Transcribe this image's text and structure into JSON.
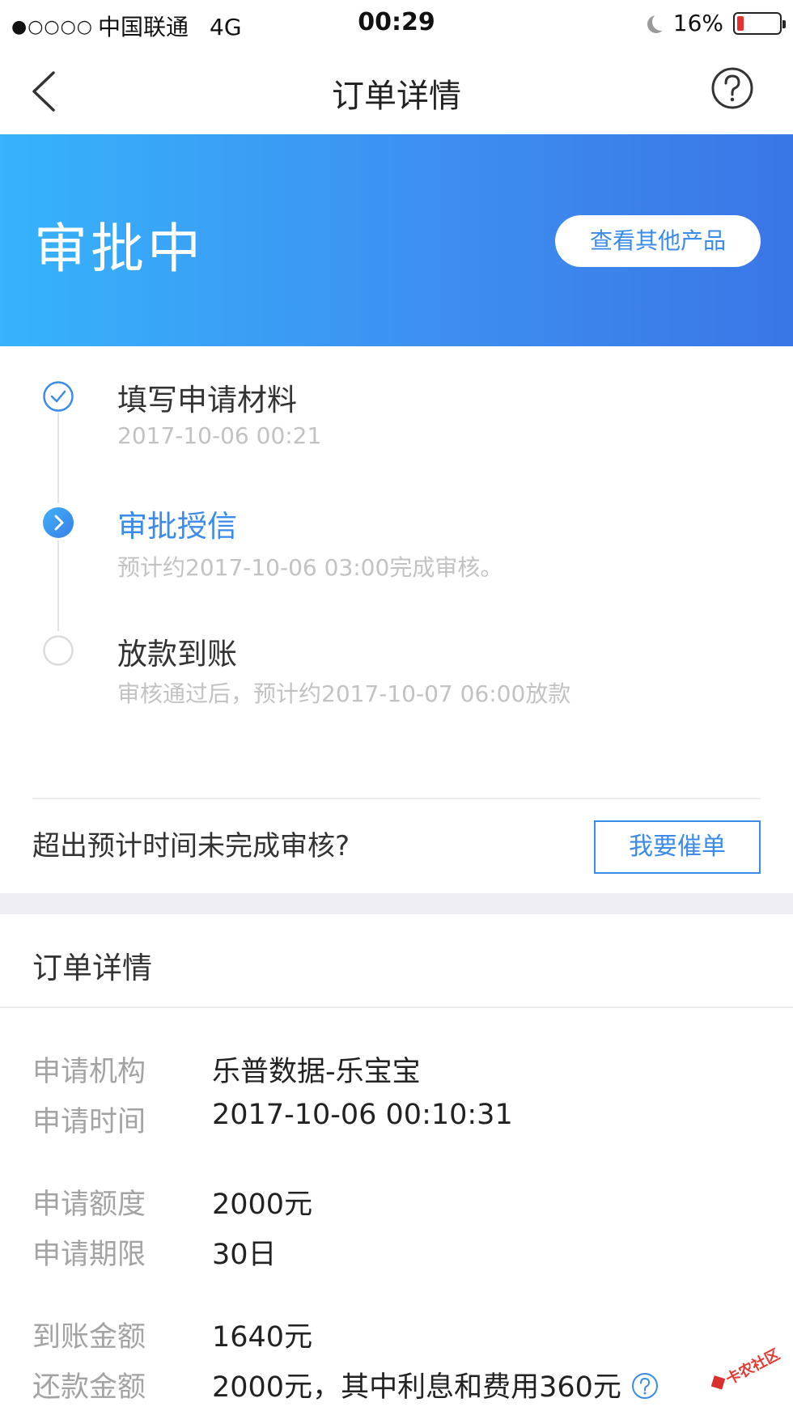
{
  "status_bar": {
    "signal_dots": "●○○○○",
    "carrier": "中国联通",
    "network": "4G",
    "time": "00:29",
    "battery_percent_text": "16%",
    "battery_level": 0.16,
    "battery_color": "#e8312f"
  },
  "nav": {
    "title": "订单详情",
    "back_icon": "chevron-left-icon",
    "help_icon": "question-circle-icon"
  },
  "banner": {
    "status": "审批中",
    "other_products_label": "查看其他产品",
    "gradient_start": "#36b3fb",
    "gradient_end": "#3a76e6"
  },
  "timeline": {
    "steps": [
      {
        "title": "填写申请材料",
        "subtitle": "2017-10-06 00:21",
        "state": "done",
        "icon": "check-circle-icon"
      },
      {
        "title": "审批授信",
        "subtitle": "预计约2017-10-06 03:00完成审核。",
        "state": "active",
        "icon": "chevron-right-circle-icon"
      },
      {
        "title": "放款到账",
        "subtitle": "审核通过后，预计约2017-10-07 06:00放款",
        "state": "pending",
        "icon": "empty-circle-icon"
      }
    ]
  },
  "urge": {
    "question": "超出预计时间未完成审核?",
    "button_label": "我要催单"
  },
  "details": {
    "section_title": "订单详情",
    "rows": [
      {
        "label": "申请机构",
        "value": "乐普数据-乐宝宝"
      },
      {
        "label": "申请时间",
        "value": "2017-10-06 00:10:31"
      },
      {
        "label": "申请额度",
        "value": "2000元"
      },
      {
        "label": "申请期限",
        "value": "30日"
      },
      {
        "label": "到账金额",
        "value": "1640元"
      },
      {
        "label": "还款金额",
        "value": "2000元，其中利息和费用360元"
      }
    ]
  },
  "watermark": {
    "text": "卡农社区"
  },
  "colors": {
    "accent": "#3a8bea",
    "muted": "#c2c2c2"
  }
}
